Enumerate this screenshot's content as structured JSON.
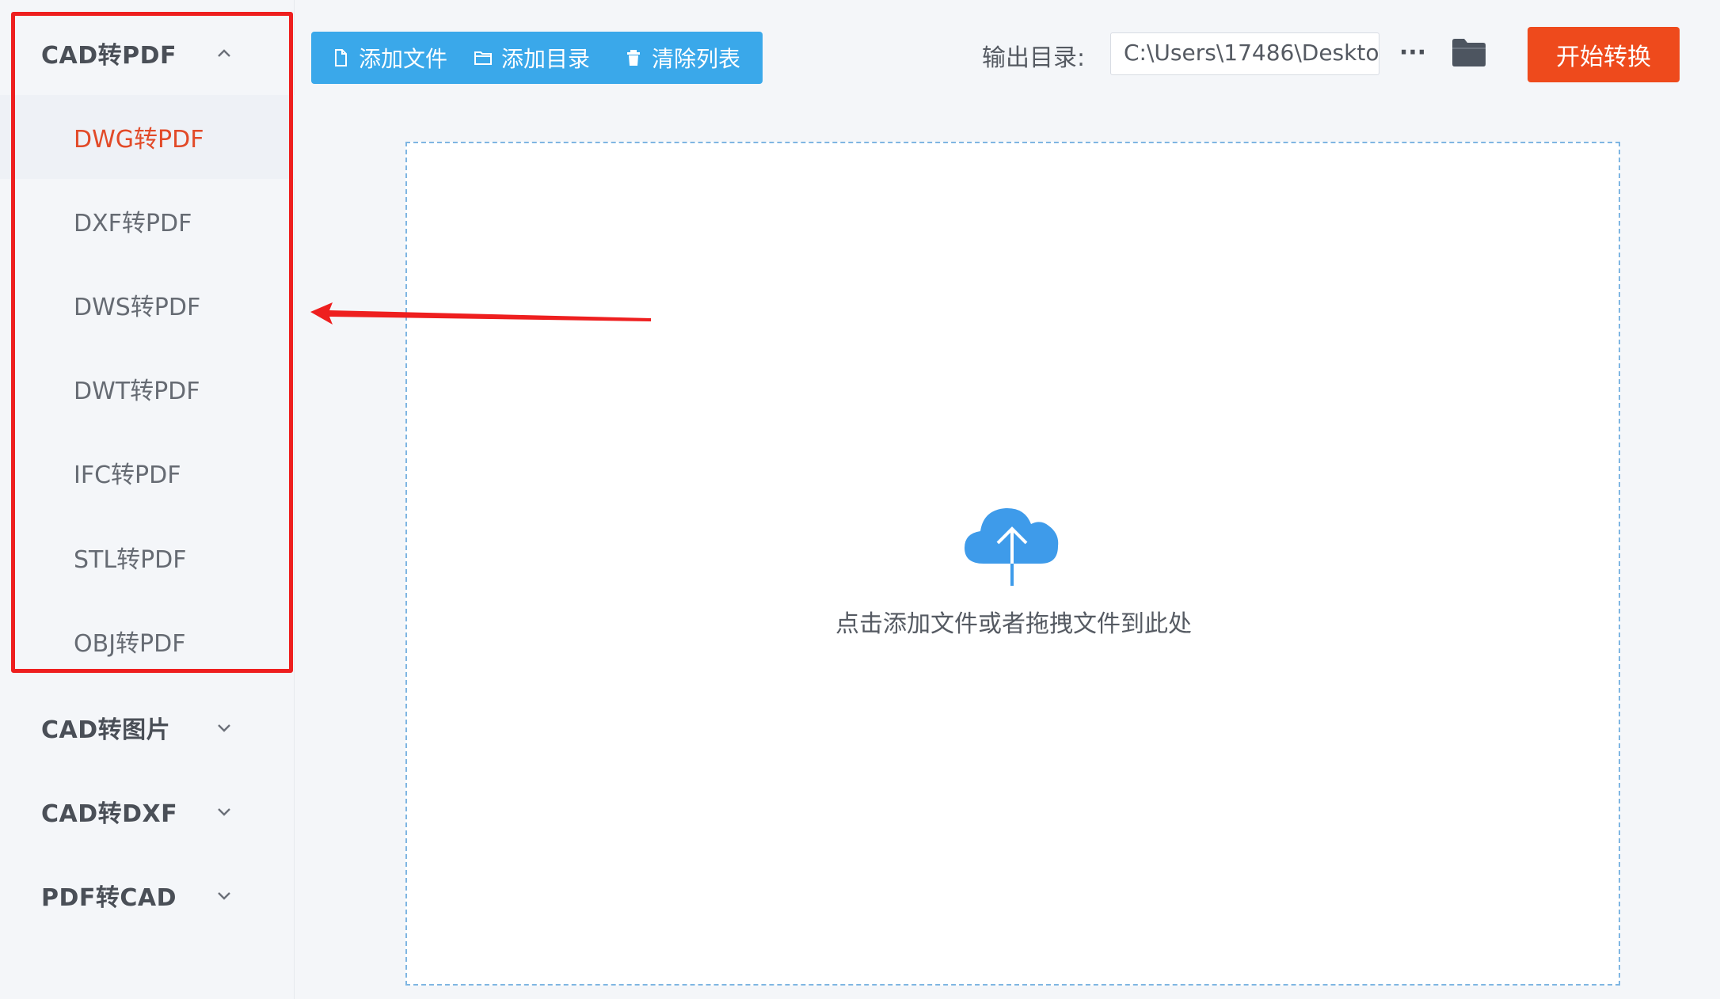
{
  "sidebar": {
    "groups": [
      {
        "label": "CAD转PDF",
        "expanded": true,
        "items": [
          {
            "label": "DWG转PDF",
            "active": true
          },
          {
            "label": "DXF转PDF"
          },
          {
            "label": "DWS转PDF"
          },
          {
            "label": "DWT转PDF"
          },
          {
            "label": "IFC转PDF"
          },
          {
            "label": "STL转PDF"
          },
          {
            "label": "OBJ转PDF"
          }
        ]
      },
      {
        "label": "CAD转图片",
        "expanded": false
      },
      {
        "label": "CAD转DXF",
        "expanded": false
      },
      {
        "label": "PDF转CAD",
        "expanded": false
      }
    ]
  },
  "toolbar": {
    "add_file_label": "添加文件",
    "add_folder_label": "添加目录",
    "clear_list_label": "清除列表",
    "output_label": "输出目录:",
    "output_path": "C:\\Users\\17486\\Deskto",
    "more_label": "···",
    "start_label": "开始转换"
  },
  "dropzone": {
    "hint": "点击添加文件或者拖拽文件到此处"
  },
  "icons": {
    "add_file": "file-icon",
    "add_folder": "folder-outline-icon",
    "clear_list": "trash-icon",
    "browse": "folder-icon",
    "upload": "cloud-upload-icon"
  },
  "colors": {
    "primary_blue": "#3aa8ea",
    "start_orange": "#ee4a1c",
    "active_item": "#e24a28",
    "annotation_red": "#ee1f1f"
  }
}
